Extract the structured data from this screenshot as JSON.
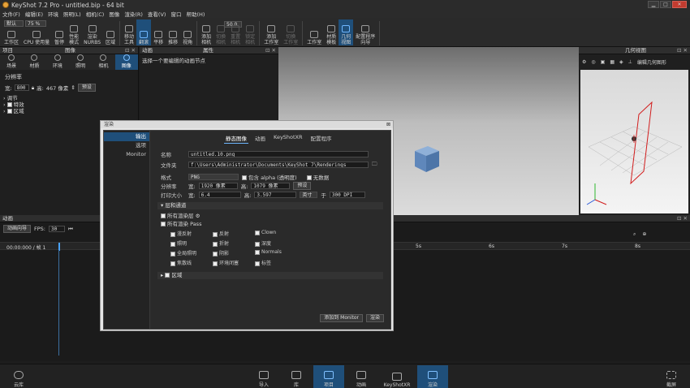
{
  "title_bar": {
    "title": "KeyShot 7.2 Pro - untitled.bip - 64 bit"
  },
  "menu": [
    "文件(F)",
    "编辑(E)",
    "环境",
    "照明(L)",
    "相机(C)",
    "图像",
    "渲染(R)",
    "查看(V)",
    "窗口",
    "帮助(H)"
  ],
  "toolbar": {
    "preset": "默认",
    "zoom": "75 %",
    "fov_value": "50.0",
    "buttons": [
      {
        "label": "工作区",
        "state": "normal"
      },
      {
        "label": "CPU 使用量",
        "state": "normal"
      },
      {
        "label": "暂停",
        "state": "normal"
      },
      {
        "label": "性能\n模式",
        "state": "normal"
      },
      {
        "label": "渲染\nNURBS",
        "state": "normal"
      },
      {
        "label": "区域",
        "state": "normal"
      },
      {
        "label": "移动\n工具",
        "state": "normal"
      },
      {
        "label": "翻滚",
        "state": "active"
      },
      {
        "label": "平移",
        "state": "normal"
      },
      {
        "label": "推移",
        "state": "normal"
      },
      {
        "label": "视角",
        "state": "normal"
      },
      {
        "label": "添加\n相机",
        "state": "normal"
      },
      {
        "label": "切换\n相机",
        "state": "dim"
      },
      {
        "label": "重置\n相机",
        "state": "dim"
      },
      {
        "label": "锁定\n相机",
        "state": "dim"
      },
      {
        "label": "添加\n工作室",
        "state": "normal"
      },
      {
        "label": "切换\n工作室",
        "state": "dim"
      },
      {
        "label": "工作室",
        "state": "normal"
      },
      {
        "label": "材质\n模板",
        "state": "normal"
      },
      {
        "label": "几何\n视图",
        "state": "active"
      },
      {
        "label": "配置程序\n向导",
        "state": "normal"
      }
    ]
  },
  "project_panel": {
    "header": "项目",
    "header2": "图像",
    "tabs": [
      {
        "label": "场景",
        "active": false
      },
      {
        "label": "材质",
        "active": false
      },
      {
        "label": "环境",
        "active": false
      },
      {
        "label": "照明",
        "active": false
      },
      {
        "label": "相机",
        "active": false
      },
      {
        "label": "图像",
        "active": true
      }
    ],
    "resolution_label": "分辨率",
    "width_label": "宽:",
    "width_value": "800",
    "height_label": "高:",
    "height_value": "467 像素",
    "preset_label": "预设",
    "tree": [
      "调节",
      "特效",
      "区域"
    ]
  },
  "animation_panel": {
    "header": "动画",
    "properties_header": "属性",
    "hint": "选择一个要编辑的动画节点"
  },
  "geometry_panel": {
    "header": "几何视图",
    "edit_label": "编辑几何图形"
  },
  "timeline": {
    "header": "动画",
    "wizard": "动画向导",
    "fps_label": "FPS:",
    "fps_value": "30",
    "time": "00:00:000 / 帧 1",
    "ticks": [
      "5s",
      "6s",
      "7s",
      "8s"
    ]
  },
  "bottom_bar": {
    "cloud": "云库",
    "buttons": [
      {
        "label": "导入",
        "active": false
      },
      {
        "label": "库",
        "active": false
      },
      {
        "label": "项目",
        "active": true
      },
      {
        "label": "动画",
        "active": false
      },
      {
        "label": "KeyShotXR",
        "active": false
      },
      {
        "label": "渲染",
        "active": true
      }
    ],
    "screenshot": "截屏"
  },
  "render_dialog": {
    "title": "渲染",
    "sidebar": [
      {
        "label": "输出",
        "active": true
      },
      {
        "label": "选项",
        "active": false
      },
      {
        "label": "Monitor",
        "active": false
      }
    ],
    "tabs": [
      {
        "label": "静态图像",
        "active": true
      },
      {
        "label": "动画",
        "active": false
      },
      {
        "label": "KeyShotXR",
        "active": false
      },
      {
        "label": "配置程序",
        "active": false
      }
    ],
    "name_label": "名称",
    "name_value": "untitled.10.png",
    "folder_label": "文件夹",
    "folder_value": "f:\\Users\\Administrator\\Documents\\KeyShot 7\\Renderings",
    "format_label": "格式",
    "format_value": "PNG",
    "alpha_label": "包含 alpha (透明度)",
    "no_light_label": "无数据",
    "resolution_label": "分辨率",
    "res_w_label": "宽:",
    "res_w_value": "1920 像素",
    "res_h_label": "高:",
    "res_h_value": "1079 像素",
    "preset_label": "预设",
    "print_label": "打印大小",
    "print_w_label": "宽:",
    "print_w_value": "6.4",
    "print_h_label": "高:",
    "print_h_value": "3.597",
    "print_unit": "英寸",
    "dpi_label": "于",
    "dpi_value": "300 DPI",
    "layers_header": "层和通道",
    "all_layers": "所有渲染层",
    "all_passes": "所有渲染 Pass",
    "passes": [
      "漫反射",
      "反射",
      "Clown",
      "照明",
      "折射",
      "深度",
      "全局照明",
      "阴影",
      "Normals",
      "焦散线",
      "环境闭塞",
      "标签"
    ],
    "region_header": "区域",
    "add_monitor": "添加到 Monitor",
    "render_button": "渲染"
  }
}
